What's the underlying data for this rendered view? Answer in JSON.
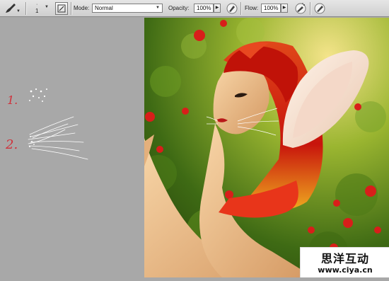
{
  "toolbar": {
    "tool_icon": "brush-icon",
    "brush_size": "1",
    "mode_label": "Mode:",
    "mode_value": "Normal",
    "opacity_label": "Opacity:",
    "opacity_value": "100%",
    "flow_label": "Flow:",
    "flow_value": "100%",
    "icons": [
      "brush-preset-picker-icon",
      "brush-panel-toggle-icon",
      "pressure-opacity-icon",
      "airbrush-icon",
      "pressure-size-icon"
    ]
  },
  "annotations": {
    "step1": "1.",
    "step2": "2."
  },
  "watermark": {
    "title": "思洋互动",
    "url": "www.ciya.cn"
  },
  "colors": {
    "toolbar_bg": "#d8d8d8",
    "canvas_gray": "#a8a8a8",
    "annotation_red": "#d0303a",
    "hair_red": "#c8140c",
    "foliage_green": "#5a8a1c"
  }
}
